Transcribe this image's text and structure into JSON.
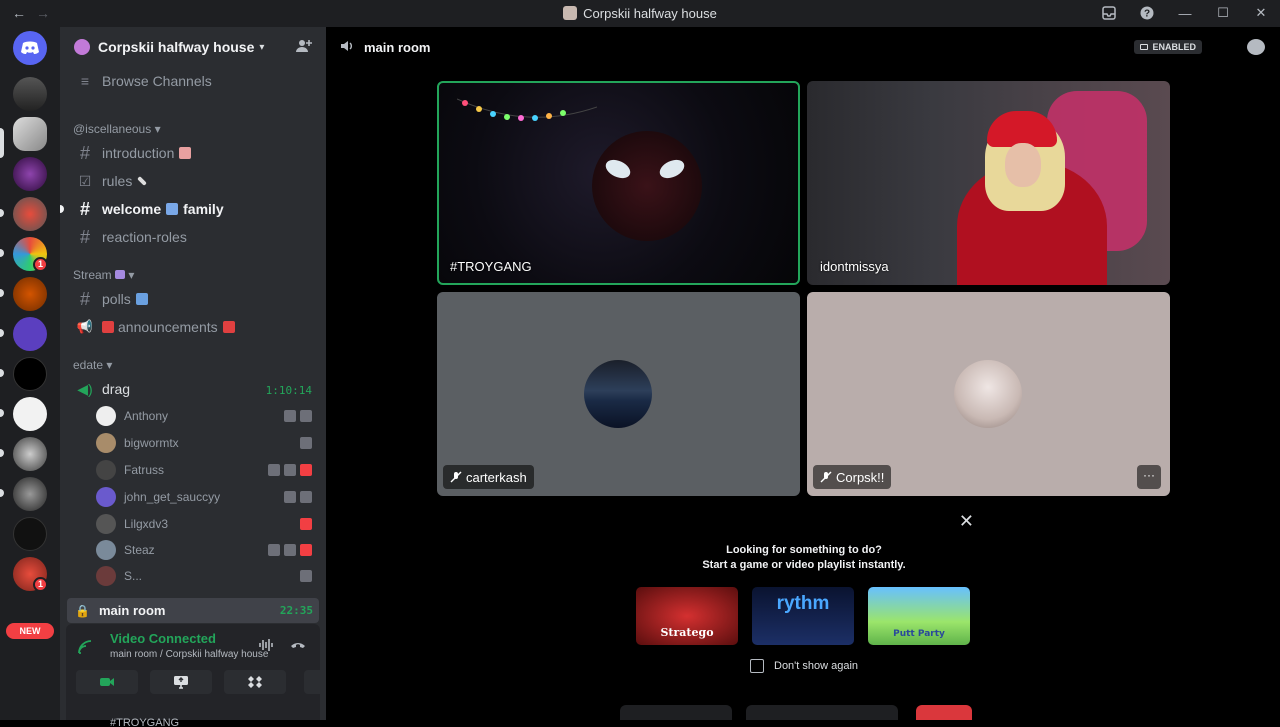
{
  "window": {
    "title": "Corpskii halfway house",
    "nav_back": "←",
    "nav_forward": "→",
    "inbox_icon": "inbox-icon",
    "help_icon": "help-icon",
    "minimize": "—",
    "maximize": "☐",
    "close": "✕"
  },
  "guilds": {
    "new_label": "NEW",
    "badges": [
      "1",
      "1"
    ]
  },
  "server": {
    "name": "Corpskii halfway house",
    "browse_channels": "Browse Channels",
    "categories": [
      {
        "name": "@iscellaneous"
      },
      {
        "name": "Stream"
      },
      {
        "name": "edate"
      }
    ],
    "channels": {
      "introduction": "introduction",
      "rules": "rules",
      "welcome": "welcome",
      "family": "family",
      "reaction_roles": "reaction-roles",
      "polls": "polls",
      "announcements": "announcements"
    },
    "voice": {
      "drag": {
        "name": "drag",
        "timer": "1:10:14"
      },
      "users": [
        "Anthony",
        "bigwormtx",
        "Fatruss",
        "john_get_sauccyy",
        "Lilgxdv3",
        "Steaz",
        "S..."
      ],
      "main_room": {
        "name": "main room",
        "timer": "22:35"
      }
    }
  },
  "voice_panel": {
    "status": "Video Connected",
    "location": "main room / Corpskii halfway house",
    "peek_user": "#TROYGANG"
  },
  "main": {
    "room_name": "main room",
    "enabled_badge": "ENABLED",
    "tiles": [
      {
        "name": "#TROYGANG"
      },
      {
        "name": "idontmissya"
      },
      {
        "name": "carterkash"
      },
      {
        "name": "Corpsk!!"
      }
    ],
    "more_label": "···"
  },
  "activity": {
    "close_label": "✕",
    "line1": "Looking for something to do?",
    "line2": "Start a game or video playlist instantly.",
    "cards": [
      "Stratego",
      "rythm",
      "Putt Party"
    ],
    "dont_show": "Don't show again"
  },
  "colors": {
    "accent_green": "#23a55a",
    "danger_red": "#f23f43",
    "sidebar_bg": "#2b2d31",
    "rail_bg": "#1e1f22"
  }
}
